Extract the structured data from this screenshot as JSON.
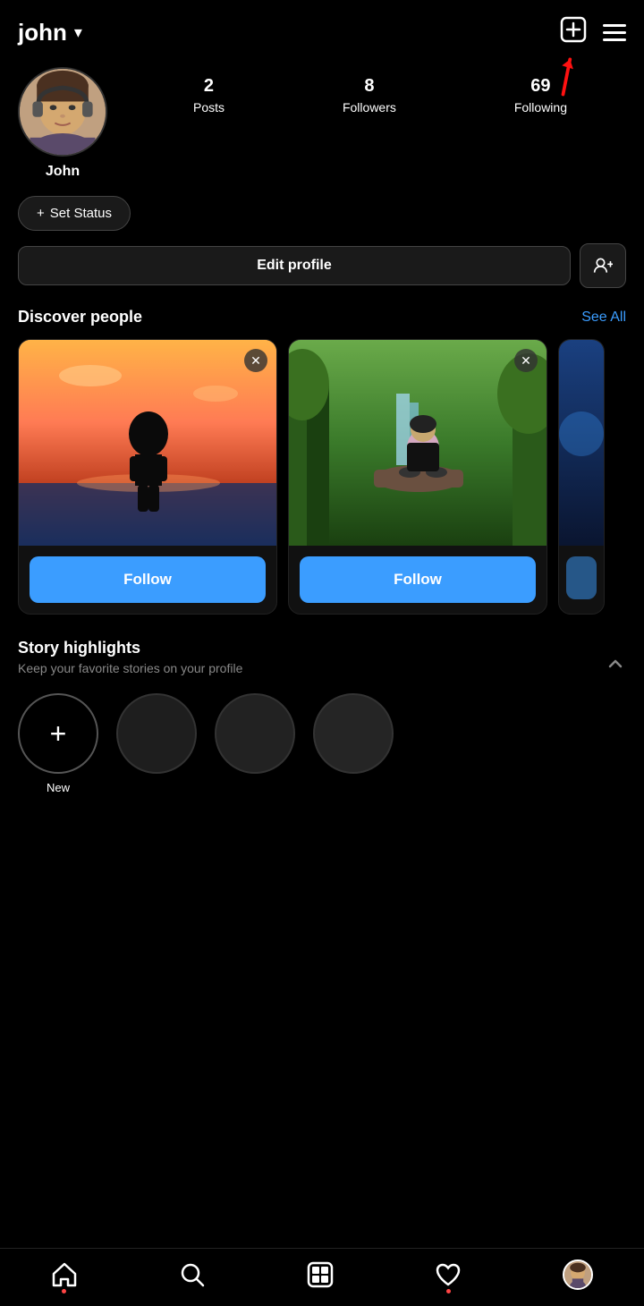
{
  "header": {
    "username": "john",
    "chevron": "▾",
    "new_post_icon": "⊕",
    "menu_icon": "☰"
  },
  "profile": {
    "display_name": "John",
    "stats": {
      "posts_count": "2",
      "posts_label": "Posts",
      "followers_count": "8",
      "followers_label": "Followers",
      "following_count": "69",
      "following_label": "Following"
    }
  },
  "set_status": {
    "label": "+ Set Status"
  },
  "edit_profile": {
    "label": "Edit profile"
  },
  "discover": {
    "title": "Discover people",
    "see_all": "See All",
    "follow_label": "Follow",
    "close_icon": "✕"
  },
  "highlights": {
    "title": "Story highlights",
    "subtitle": "Keep your favorite stories on your profile",
    "chevron_up": "^",
    "new_label": "New"
  },
  "bottom_nav": {
    "home": "⌂",
    "search": "○",
    "reels": "▣",
    "activity": "♡",
    "profile": "👤"
  },
  "colors": {
    "accent_blue": "#3b9dff",
    "bg": "#000000",
    "card_bg": "#111111",
    "border": "#333333"
  }
}
